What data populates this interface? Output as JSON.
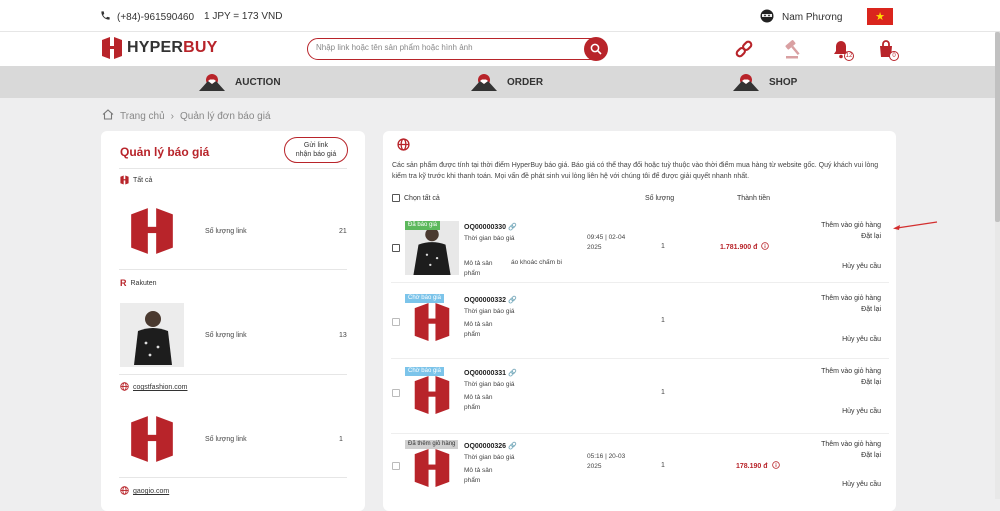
{
  "topbar": {
    "phone": "(+84)-961590460",
    "rate": "1 JPY = 173 VND",
    "user_name": "Nam Phương"
  },
  "header": {
    "logo_a": "HYPER",
    "logo_b": "BUY",
    "search_placeholder": "Nhập link hoặc tên sản phẩm hoặc hình ảnh",
    "bell_count": "12",
    "cart_count": "0"
  },
  "nav": {
    "auction": "AUCTION",
    "order": "ORDER",
    "shop": "SHOP"
  },
  "breadcrumb": {
    "home": "Trang chủ",
    "sep": "›",
    "current": "Quản lý đơn báo giá"
  },
  "left": {
    "title": "Quản lý báo giá",
    "send_line1": "Gửi link",
    "send_line2": "nhận báo giá",
    "all_label": "Tất cả",
    "sources": [
      {
        "name": "",
        "label": "Số lượng link",
        "count": "21"
      },
      {
        "name": "Rakuten",
        "label": "Số lượng link",
        "count": "13"
      },
      {
        "name": "cogstfashion.com",
        "label": "Số lượng link",
        "count": "1"
      },
      {
        "name": "gaogio.com"
      }
    ]
  },
  "right": {
    "notice": "Các sản phẩm được tính tại thời điểm HyperBuy báo giá. Báo giá có thể thay đổi hoặc tuỳ thuộc vào thời điểm mua hàng từ website gốc. Quý khách vui lòng kiểm tra kỹ trước khi thanh toán. Mọi vấn đề phát sinh vui lòng liên hệ với chúng tôi để được giải quyết nhanh nhất.",
    "select_all": "Chọn tất cả",
    "col_qty": "Số lượng",
    "col_total": "Thành tiền",
    "quote_time_label": "Thời gian báo giá",
    "desc_label": "Mô tả sản phẩm",
    "desc_line1": "Mô tả sản",
    "desc_line2": "phẩm",
    "add_cart": "Thêm vào giỏ hàng",
    "reorder": "Đặt lại",
    "cancel": "Hủy yêu cầu",
    "orders": [
      {
        "tag": "Đã báo giá",
        "tag_color": "#5cb85c",
        "code": "OQ00000330",
        "time1": "09:45 | 02-04",
        "time2": "2025",
        "desc_extra": "áo khoác chấm bi",
        "qty": "1",
        "price": "1.781.900 đ"
      },
      {
        "tag": "Chờ báo giá",
        "tag_color": "#7cc4ea",
        "code": "OQ00000332",
        "time1": "",
        "time2": "",
        "desc_extra": "",
        "qty": "1",
        "price": ""
      },
      {
        "tag": "Chờ báo giá",
        "tag_color": "#7cc4ea",
        "code": "OQ00000331",
        "time1": "",
        "time2": "",
        "desc_extra": "",
        "qty": "1",
        "price": ""
      },
      {
        "tag": "Đã thêm giỏ hàng",
        "tag_color": "#cfcfcf",
        "code": "OQ00000326",
        "time1": "05:16 | 20-03",
        "time2": "2025",
        "desc_extra": "",
        "qty": "1",
        "price": "178.190 đ"
      }
    ]
  }
}
